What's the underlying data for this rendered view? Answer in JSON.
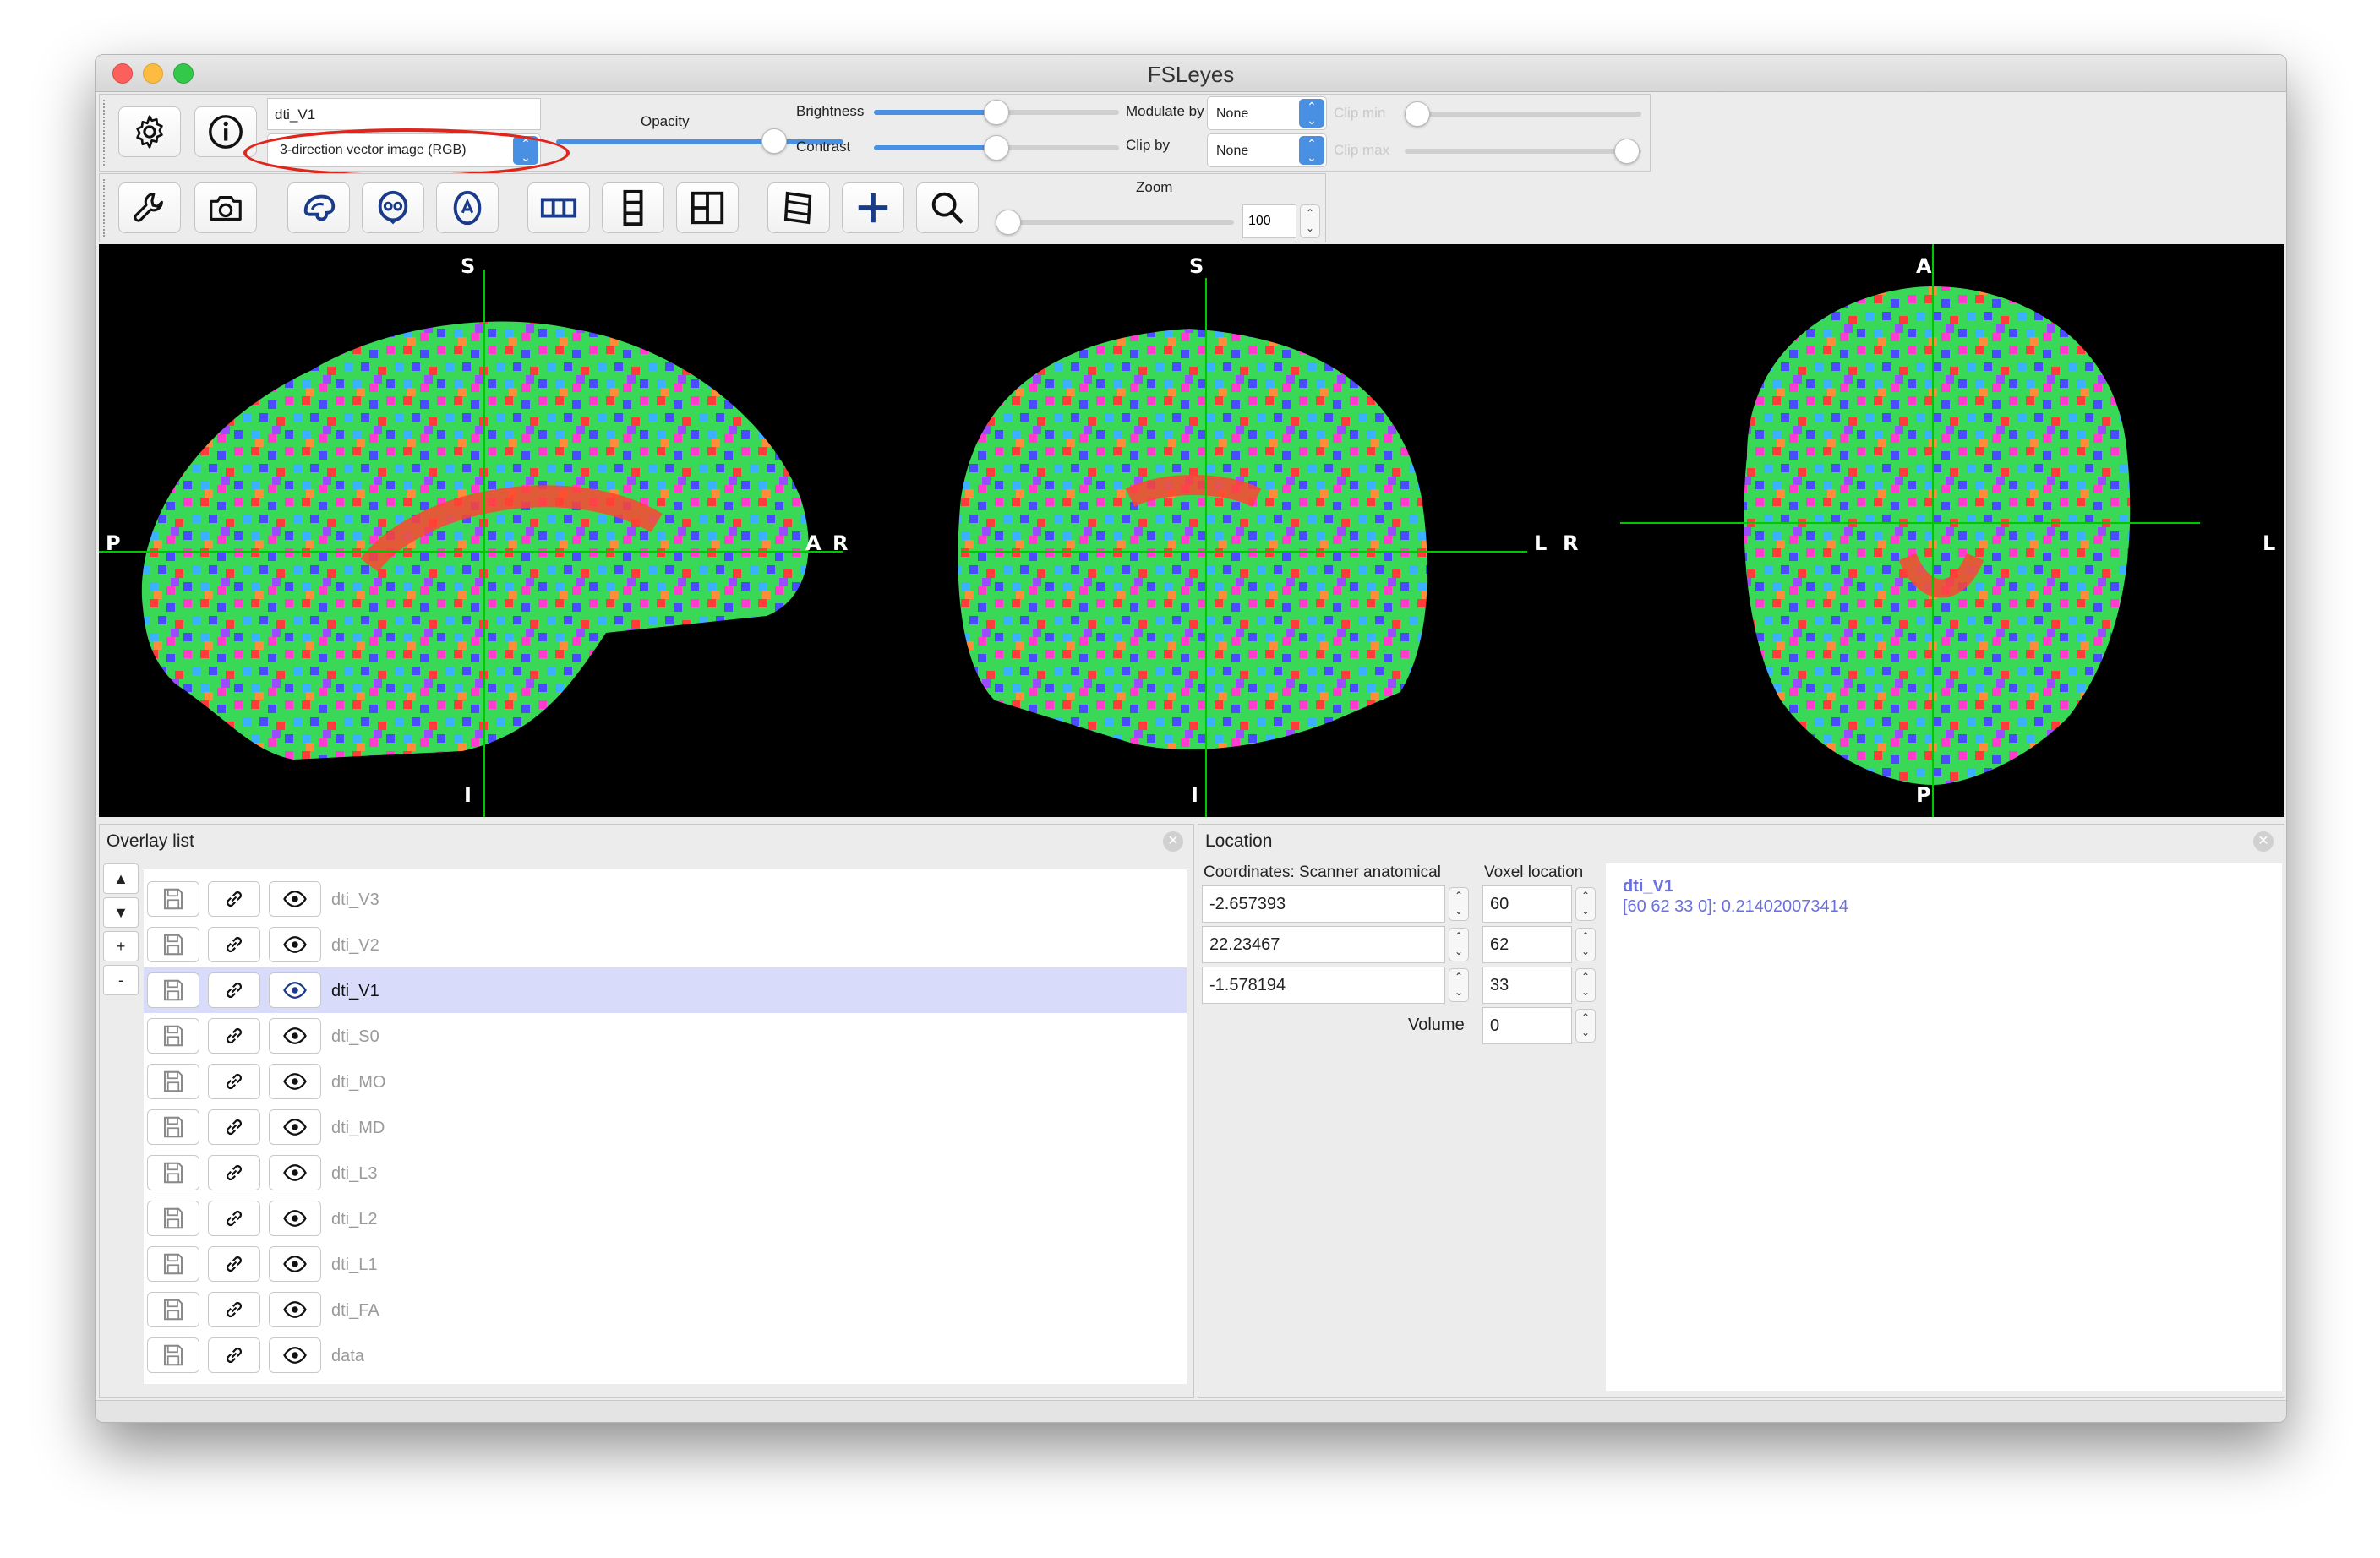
{
  "window": {
    "title": "FSLeyes"
  },
  "overlay_toolbar": {
    "name_value": "dti_V1",
    "type_select": "3-direction vector image (RGB)",
    "opacity_label": "Opacity",
    "brightness_label": "Brightness",
    "contrast_label": "Contrast",
    "modulate_label": "Modulate by",
    "modulate_value": "None",
    "clip_label": "Clip by",
    "clip_value": "None",
    "clip_min_label": "Clip min",
    "clip_max_label": "Clip max",
    "opacity_level": 1.0,
    "brightness_level": 0.5,
    "contrast_level": 0.5
  },
  "view_toolbar": {
    "zoom_label": "Zoom",
    "zoom_value": "100"
  },
  "icons": [
    "gear-icon",
    "info-icon",
    "wrench-icon",
    "camera-icon",
    "sagittal-icon",
    "coronal-icon",
    "axial-icon",
    "layout-horizontal-icon",
    "layout-vertical-icon",
    "layout-grid-icon",
    "movie-icon",
    "crosshair-icon",
    "zoom-icon",
    "save-icon",
    "link-icon",
    "eye-icon"
  ],
  "viewer": {
    "sagittal": {
      "top": "S",
      "bottom": "I",
      "left": "P",
      "right": "A"
    },
    "coronal": {
      "top": "S",
      "bottom": "I",
      "left": "R",
      "right": "L"
    },
    "axial": {
      "top": "A",
      "bottom": "P",
      "left": "R",
      "right": "L"
    },
    "crosshair_color": "#00c800"
  },
  "overlay_list": {
    "title": "Overlay list",
    "side_buttons": [
      "▲",
      "▼",
      "+",
      "-"
    ],
    "items": [
      {
        "name": "dti_V3",
        "selected": false
      },
      {
        "name": "dti_V2",
        "selected": false
      },
      {
        "name": "dti_V1",
        "selected": true
      },
      {
        "name": "dti_S0",
        "selected": false
      },
      {
        "name": "dti_MO",
        "selected": false
      },
      {
        "name": "dti_MD",
        "selected": false
      },
      {
        "name": "dti_L3",
        "selected": false
      },
      {
        "name": "dti_L2",
        "selected": false
      },
      {
        "name": "dti_L1",
        "selected": false
      },
      {
        "name": "dti_FA",
        "selected": false
      },
      {
        "name": "data",
        "selected": false
      }
    ]
  },
  "location": {
    "title": "Location",
    "coords_label": "Coordinates: Scanner anatomical",
    "voxel_label": "Voxel location",
    "coords": [
      "-2.657393",
      "22.23467",
      "-1.578194"
    ],
    "voxel": [
      "60",
      "62",
      "33"
    ],
    "volume_label": "Volume",
    "volume_value": "0",
    "info_name": "dti_V1",
    "info_value": "[60 62 33 0]: 0.214020073414"
  },
  "colors": {
    "accent": "#4a90e2",
    "highlight_ellipse": "#e0261c",
    "selected_row": "#d9dbfa",
    "info_text": "#6b6fe0"
  }
}
